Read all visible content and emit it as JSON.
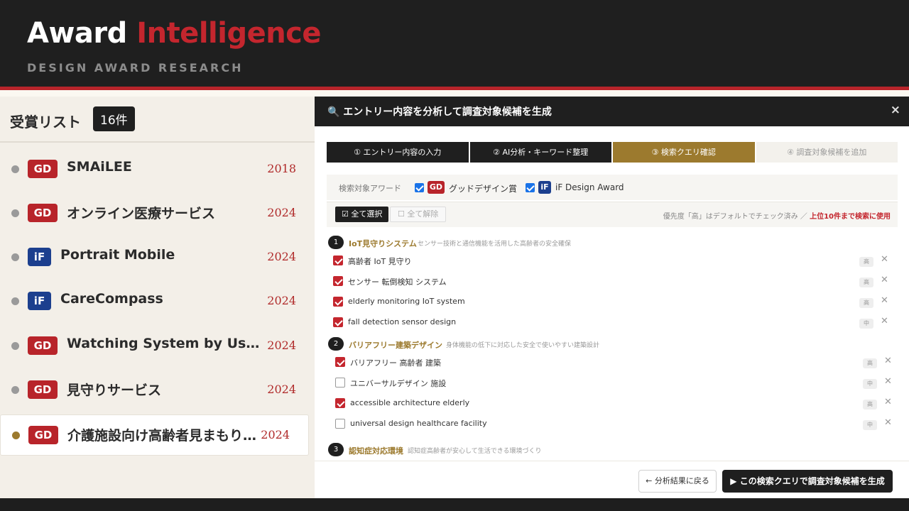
{
  "header": {
    "brand_word1": "Award",
    "brand_word2": "Intelligence",
    "tagline": "DESIGN AWARD RESEARCH"
  },
  "colors": {
    "brand_red": "#c4262e",
    "gold": "#9c7a2e",
    "dark": "#1f1f1f",
    "if_blue": "#1c3f8e"
  },
  "award_list": {
    "title": "受賞リスト",
    "count": "16件",
    "items": [
      {
        "badge": "GD",
        "name": "SMAiLEE",
        "year": "2018"
      },
      {
        "badge": "GD",
        "name": "オンライン医療サービス",
        "year": "2024"
      },
      {
        "badge": "iF",
        "name": "Portrait Mobile",
        "year": "2024"
      },
      {
        "badge": "iF",
        "name": "CareCompass",
        "year": "2024"
      },
      {
        "badge": "GD",
        "name": "Watching System by Using …",
        "year": "2024"
      },
      {
        "badge": "GD",
        "name": "見守りサービス",
        "year": "2024"
      },
      {
        "badge": "GD",
        "name": "介護施設向け高齢者見まもり…",
        "year": "2024",
        "selected": true
      }
    ]
  },
  "modal": {
    "title": "🔍 エントリー内容を分析して調査対象候補を生成",
    "close_icon": "×",
    "steps": [
      {
        "label": "① エントリー内容の入力",
        "state": "done"
      },
      {
        "label": "② AI分析・キーワード整理",
        "state": "done"
      },
      {
        "label": "③ 検索クエリ確認",
        "state": "active"
      },
      {
        "label": "④ 調査対象候補を追加",
        "state": "pending"
      }
    ],
    "target": {
      "label": "検索対象アワード",
      "gd_badge": "GD",
      "gd_name": "グッドデザイン賞",
      "if_badge": "iF",
      "if_name": "iF Design Award"
    },
    "select": {
      "all_label": "☑ 全て選択",
      "none_label": "☐ 全て解除",
      "note_prefix": "優先度「高」はデフォルトでチェック済み ／ ",
      "note_emphasis": "上位10件まで検索に使用"
    },
    "groups": [
      {
        "num": "1",
        "title": "IoT見守りシステム",
        "desc": "センサー技術と通信機能を活用した高齢者の安全確保",
        "queries": [
          {
            "text": "高齢者 IoT 見守り",
            "checked": true,
            "priority": "高"
          },
          {
            "text": "センサー 転倒検知 システム",
            "checked": true,
            "priority": "高"
          },
          {
            "text": "elderly monitoring IoT system",
            "checked": true,
            "priority": "高"
          },
          {
            "text": "fall detection sensor design",
            "checked": true,
            "priority": "中"
          }
        ]
      },
      {
        "num": "2",
        "title": "バリアフリー建築デザイン",
        "desc": "身体機能の低下に対応した安全で使いやすい建築設計",
        "queries": [
          {
            "text": "バリアフリー 高齢者 建築",
            "checked": true,
            "priority": "高"
          },
          {
            "text": "ユニバーサルデザイン 施設",
            "checked": false,
            "priority": "中"
          },
          {
            "text": "accessible architecture elderly",
            "checked": true,
            "priority": "高"
          },
          {
            "text": "universal design healthcare facility",
            "checked": false,
            "priority": "中"
          }
        ]
      },
      {
        "num": "3",
        "title": "認知症対応環境",
        "desc": "認知症高齢者が安心して生活できる環境づくり",
        "queries": []
      }
    ],
    "footer": {
      "back_label": "← 分析結果に戻る",
      "generate_label": "▶ この検索クエリで調査対象候補を生成"
    }
  }
}
